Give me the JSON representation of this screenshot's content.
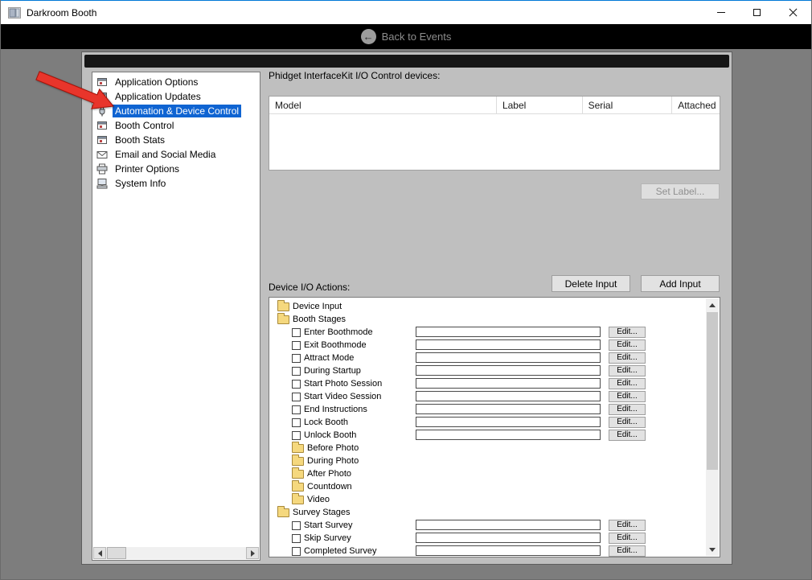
{
  "window": {
    "title": "Darkroom Booth"
  },
  "nav": {
    "back_glyph": "←",
    "back_label": "Back to Events"
  },
  "sidebar": {
    "items": [
      {
        "label": "Application Options",
        "icon": "app-window",
        "selected": false
      },
      {
        "label": "Application Updates",
        "icon": "app-window",
        "selected": false
      },
      {
        "label": "Automation & Device Control",
        "icon": "plug",
        "selected": true
      },
      {
        "label": "Booth Control",
        "icon": "app-window",
        "selected": false
      },
      {
        "label": "Booth Stats",
        "icon": "app-window",
        "selected": false
      },
      {
        "label": "Email and Social Media",
        "icon": "envelope",
        "selected": false
      },
      {
        "label": "Printer Options",
        "icon": "printer",
        "selected": false
      },
      {
        "label": "System Info",
        "icon": "computer",
        "selected": false
      }
    ]
  },
  "devices": {
    "label": "Phidget InterfaceKit I/O Control devices:",
    "columns": [
      "Model",
      "Label",
      "Serial",
      "Attached"
    ],
    "rows": [],
    "set_label_button": "Set Label...",
    "delete_input_button": "Delete Input",
    "add_input_button": "Add Input"
  },
  "actions": {
    "label": "Device I/O Actions:",
    "edit_label": "Edit...",
    "items": [
      {
        "type": "folder",
        "label": "Device Input",
        "indent": 0
      },
      {
        "type": "folder",
        "label": "Booth Stages",
        "indent": 0
      },
      {
        "type": "action",
        "label": "Enter Boothmode",
        "indent": 1,
        "checked": false,
        "value": ""
      },
      {
        "type": "action",
        "label": "Exit Boothmode",
        "indent": 1,
        "checked": false,
        "value": ""
      },
      {
        "type": "action",
        "label": "Attract Mode",
        "indent": 1,
        "checked": false,
        "value": ""
      },
      {
        "type": "action",
        "label": "During Startup",
        "indent": 1,
        "checked": false,
        "value": ""
      },
      {
        "type": "action",
        "label": "Start Photo Session",
        "indent": 1,
        "checked": false,
        "value": ""
      },
      {
        "type": "action",
        "label": "Start Video Session",
        "indent": 1,
        "checked": false,
        "value": ""
      },
      {
        "type": "action",
        "label": "End Instructions",
        "indent": 1,
        "checked": false,
        "value": ""
      },
      {
        "type": "action",
        "label": "Lock Booth",
        "indent": 1,
        "checked": false,
        "value": ""
      },
      {
        "type": "action",
        "label": "Unlock Booth",
        "indent": 1,
        "checked": false,
        "value": ""
      },
      {
        "type": "folder",
        "label": "Before Photo",
        "indent": 1
      },
      {
        "type": "folder",
        "label": "During Photo",
        "indent": 1
      },
      {
        "type": "folder",
        "label": "After Photo",
        "indent": 1
      },
      {
        "type": "folder",
        "label": "Countdown",
        "indent": 1
      },
      {
        "type": "folder",
        "label": "Video",
        "indent": 1
      },
      {
        "type": "folder",
        "label": "Survey Stages",
        "indent": 0
      },
      {
        "type": "action",
        "label": "Start Survey",
        "indent": 1,
        "checked": false,
        "value": ""
      },
      {
        "type": "action",
        "label": "Skip Survey",
        "indent": 1,
        "checked": false,
        "value": ""
      },
      {
        "type": "action",
        "label": "Completed Survey",
        "indent": 1,
        "checked": false,
        "value": ""
      }
    ]
  },
  "colors": {
    "selection_highlight": "#0f64d2",
    "window_accent_border": "#0078d7",
    "annotation_arrow": "#e8352b",
    "navbar_bg": "#000000",
    "panel_bg": "#bfbfbf"
  }
}
